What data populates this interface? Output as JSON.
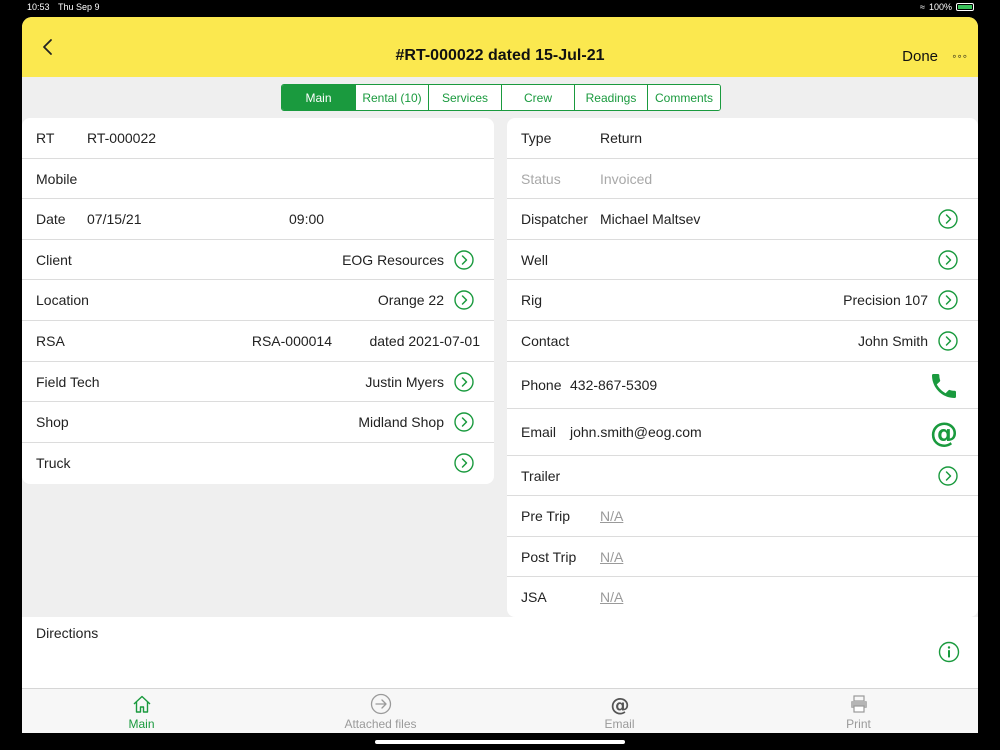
{
  "status_bar": {
    "time": "10:53",
    "day": "Thu Sep 9",
    "battery": "100%"
  },
  "nav": {
    "title": "#RT-000022 dated 15-Jul-21",
    "done_label": "Done",
    "more_label": "◦◦◦"
  },
  "tabs": [
    {
      "label": "Main",
      "active": true
    },
    {
      "label": "Rental (10)"
    },
    {
      "label": "Services"
    },
    {
      "label": "Crew"
    },
    {
      "label": "Readings"
    },
    {
      "label": "Comments"
    }
  ],
  "left": {
    "rt": {
      "label": "RT",
      "value": "RT-000022"
    },
    "mobile": {
      "label": "Mobile"
    },
    "date": {
      "label": "Date",
      "value": "07/15/21",
      "time": "09:00"
    },
    "client": {
      "label": "Client",
      "value": "EOG Resources"
    },
    "location": {
      "label": "Location",
      "value": "Orange 22"
    },
    "rsa": {
      "label": "RSA",
      "value": "RSA-000014",
      "dated": "dated 2021-07-01"
    },
    "field_tech": {
      "label": "Field Tech",
      "value": "Justin Myers"
    },
    "shop": {
      "label": "Shop",
      "value": "Midland Shop"
    },
    "truck": {
      "label": "Truck"
    }
  },
  "right": {
    "type": {
      "label": "Type",
      "value": "Return"
    },
    "status": {
      "label": "Status",
      "value": "Invoiced"
    },
    "dispatcher": {
      "label": "Dispatcher",
      "value": "Michael Maltsev"
    },
    "well": {
      "label": "Well"
    },
    "rig": {
      "label": "Rig",
      "value": "Precision 107"
    },
    "contact": {
      "label": "Contact",
      "value": "John Smith"
    },
    "phone": {
      "label": "Phone",
      "value": "432-867-5309"
    },
    "email": {
      "label": "Email",
      "value": "john.smith@eog.com"
    },
    "trailer": {
      "label": "Trailer"
    },
    "pre_trip": {
      "label": "Pre Trip",
      "value": "N/A"
    },
    "post_trip": {
      "label": "Post Trip",
      "value": "N/A"
    },
    "jsa": {
      "label": "JSA",
      "value": "N/A"
    }
  },
  "directions": {
    "label": "Directions"
  },
  "tabbar": [
    {
      "label": "Main",
      "icon": "home-icon",
      "active": true
    },
    {
      "label": "Attached files",
      "icon": "arrow-circle-icon"
    },
    {
      "label": "Email",
      "icon": "at-icon"
    },
    {
      "label": "Print",
      "icon": "printer-icon"
    }
  ],
  "colors": {
    "accent": "#1a9a3e",
    "navbar": "#fbe84f"
  }
}
